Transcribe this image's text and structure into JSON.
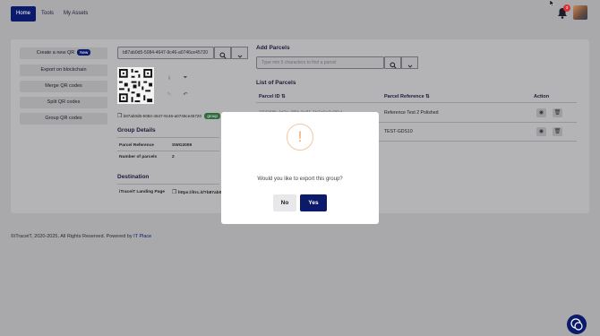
{
  "nav": {
    "home": "Home",
    "tools": "Tools",
    "my_assets": "My Assets",
    "notification_count": "3"
  },
  "sidebar": {
    "items": [
      {
        "label": "Create a new QR",
        "badge": "New"
      },
      {
        "label": "Export on blockchain"
      },
      {
        "label": "Merge QR codes"
      },
      {
        "label": "Split QR codes"
      },
      {
        "label": "Group QR codes"
      }
    ]
  },
  "qr_panel": {
    "search_value": "b87ab0d5-5084-4647-9c46-a0746ce45720",
    "identifier": "b87ab0d5-5084-4647-9c46-a0746ce45720",
    "tag": "group"
  },
  "group_details": {
    "title": "Group Details",
    "parcel_reference_label": "Parcel Reference",
    "parcel_reference_value": "SWG2009",
    "number_label": "Number of parcels",
    "number_value": "2"
  },
  "destination": {
    "title": "Destination",
    "landing_label": "iTraceiT Landing Page",
    "landing_url": "https://itrc.it/?b87ab0d5"
  },
  "add_parcels": {
    "title": "Add Parcels",
    "placeholder": "Type min 5 characters to find a parcel"
  },
  "parcels_list": {
    "title": "List of Parcels",
    "headers": [
      "Parcel ID",
      "Parcel Reference",
      "Action"
    ],
    "rows": [
      {
        "id": "1f1f1f0fb-4d2e-4f5b-9c81-1b7e0e3c0f1d",
        "reference": "Reference Test 2 Polished"
      },
      {
        "id": "",
        "reference": "TEST-GDS10"
      }
    ]
  },
  "footer": {
    "text": "©iTraceiT, 2020-2025. All Rights Reserved. Powered by ",
    "link": "IT Place"
  },
  "modal": {
    "icon": "!",
    "message": "Would you like to export this group?",
    "no": "No",
    "yes": "Yes"
  },
  "colors": {
    "primary": "#0c1a6b",
    "warning": "#f1a86a",
    "badge": "#d33333"
  }
}
